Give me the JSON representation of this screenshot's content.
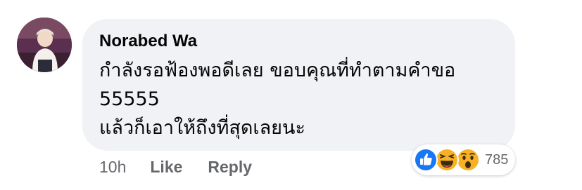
{
  "comment": {
    "author": "Norabed Wa",
    "text_lines": [
      "กำลังรอฟ้องพอดีเลย ขอบคุณที่ทำตามคำขอ",
      "55555",
      "แล้วก็เอาให้ถึงที่สุดเลยนะ"
    ],
    "timestamp": "10h",
    "like_label": "Like",
    "reply_label": "Reply",
    "reactions": {
      "icons": [
        "like-icon",
        "haha-icon",
        "wow-icon"
      ],
      "count": "785"
    }
  },
  "colors": {
    "bubble_bg": "#f0f2f5",
    "text": "#050505",
    "secondary_text": "#65676b",
    "like_blue": "#1877f2",
    "emoji_yellow": "#f7b125"
  }
}
